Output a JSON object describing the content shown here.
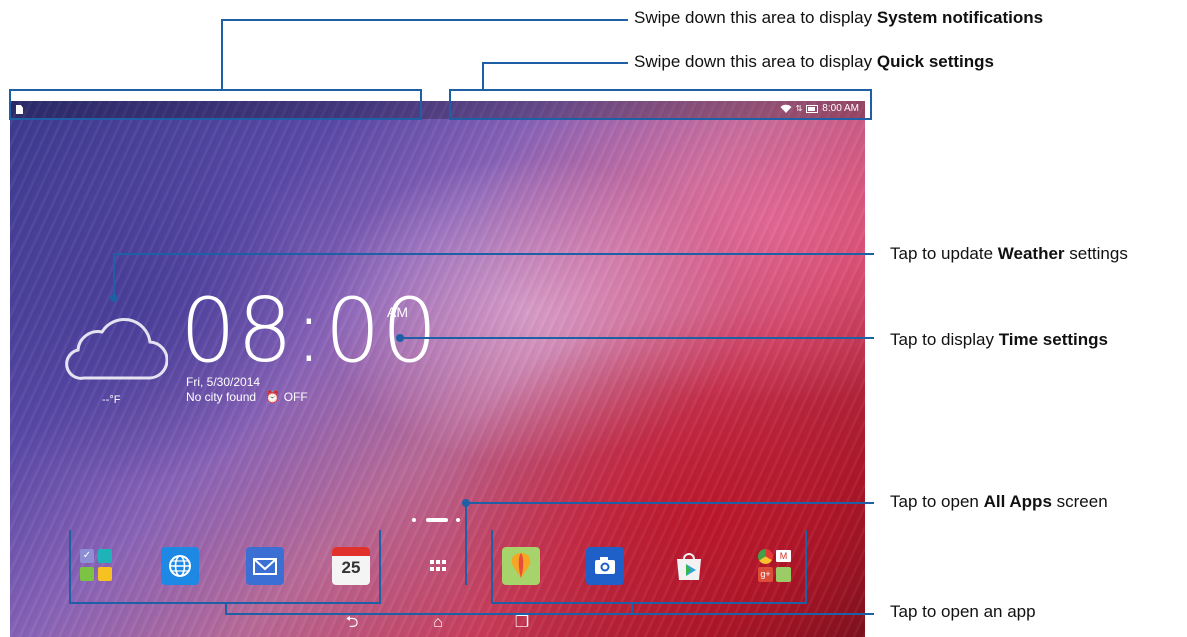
{
  "annotations": {
    "system_notifications": {
      "pre": "Swipe down this area to display ",
      "bold": "System notifications",
      "post": ""
    },
    "quick_settings": {
      "pre": "Swipe down this area to display ",
      "bold": "Quick settings",
      "post": ""
    },
    "weather": {
      "pre": "Tap to update ",
      "bold": "Weather",
      "post": " settings"
    },
    "time": {
      "pre": "Tap to display ",
      "bold": "Time settings",
      "post": ""
    },
    "all_apps": {
      "pre": "Tap to open ",
      "bold": "All Apps",
      "post": " screen"
    },
    "open_app": {
      "pre": "Tap to open an app",
      "bold": "",
      "post": ""
    }
  },
  "status_bar": {
    "time": "8:00 AM"
  },
  "weather_widget": {
    "temperature": "--°F",
    "icon": "cloud-icon"
  },
  "clock_widget": {
    "time": "08:00",
    "ampm": "AM",
    "date": "Fri, 5/30/2014",
    "city": "No city found",
    "alarm": "OFF"
  },
  "dock": {
    "calendar_day": "25",
    "icons": [
      "folder-icon",
      "browser-icon",
      "email-icon",
      "calendar-icon",
      "all-apps-icon",
      "weather-app-icon",
      "camera-icon",
      "play-store-icon",
      "google-folder-icon"
    ]
  },
  "navbar": {
    "back": "back-icon",
    "home": "home-icon",
    "recent": "recent-apps-icon"
  },
  "colors": {
    "callout_line": "#1f5fa6",
    "screen_accent": "#c83c5a"
  }
}
